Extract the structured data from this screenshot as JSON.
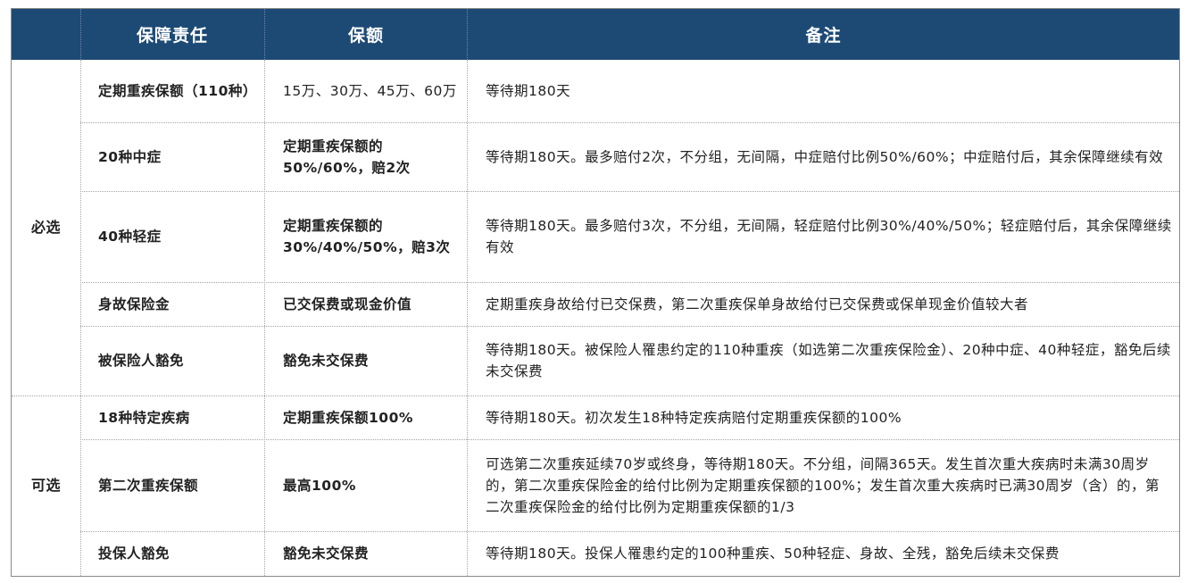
{
  "header": {
    "col1": "保障责任",
    "col2": "保额",
    "col3": "备注"
  },
  "groups": {
    "required": "必选",
    "optional": "可选"
  },
  "rows": [
    {
      "name": "定期重疾保额（110种）",
      "amount": "15万、30万、45万、60万",
      "note": "等待期180天"
    },
    {
      "name": "20种中症",
      "amount": "定期重疾保额的50%/60%，赔2次",
      "note": "等待期180天。最多赔付2次，不分组，无间隔，中症赔付比例50%/60%；中症赔付后，其余保障继续有效"
    },
    {
      "name": "40种轻症",
      "amount": "定期重疾保额的30%/40%/50%，赔3次",
      "note": "等待期180天。最多赔付3次，不分组，无间隔，轻症赔付比例30%/40%/50%；轻症赔付后，其余保障继续有效"
    },
    {
      "name": "身故保险金",
      "amount": "已交保费或现金价值",
      "note": "定期重疾身故给付已交保费，第二次重疾保单身故给付已交保费或保单现金价值较大者"
    },
    {
      "name": "被保险人豁免",
      "amount": "豁免未交保费",
      "note": "等待期180天。被保险人罹患约定的110种重疾（如选第二次重疾保险金）、20种中症、40种轻症，豁免后续未交保费"
    },
    {
      "name": "18种特定疾病",
      "amount": "定期重疾保额100%",
      "note": "等待期180天。初次发生18种特定疾病赔付定期重疾保额的100%"
    },
    {
      "name": "第二次重疾保额",
      "amount": "最高100%",
      "note": "可选第二次重疾延续70岁或终身，等待期180天。不分组，间隔365天。发生首次重大疾病时未满30周岁的，第二次重疾保险金的给付比例为定期重疾保额的100%；发生首次重大疾病时已满30周岁（含）的，第二次重疾保险金的给付比例为定期重疾保额的1/3"
    },
    {
      "name": "投保人豁免",
      "amount": "豁免未交保费",
      "note": "等待期180天。投保人罹患约定的100种重疾、50种轻症、身故、全残，豁免后续未交保费"
    }
  ]
}
